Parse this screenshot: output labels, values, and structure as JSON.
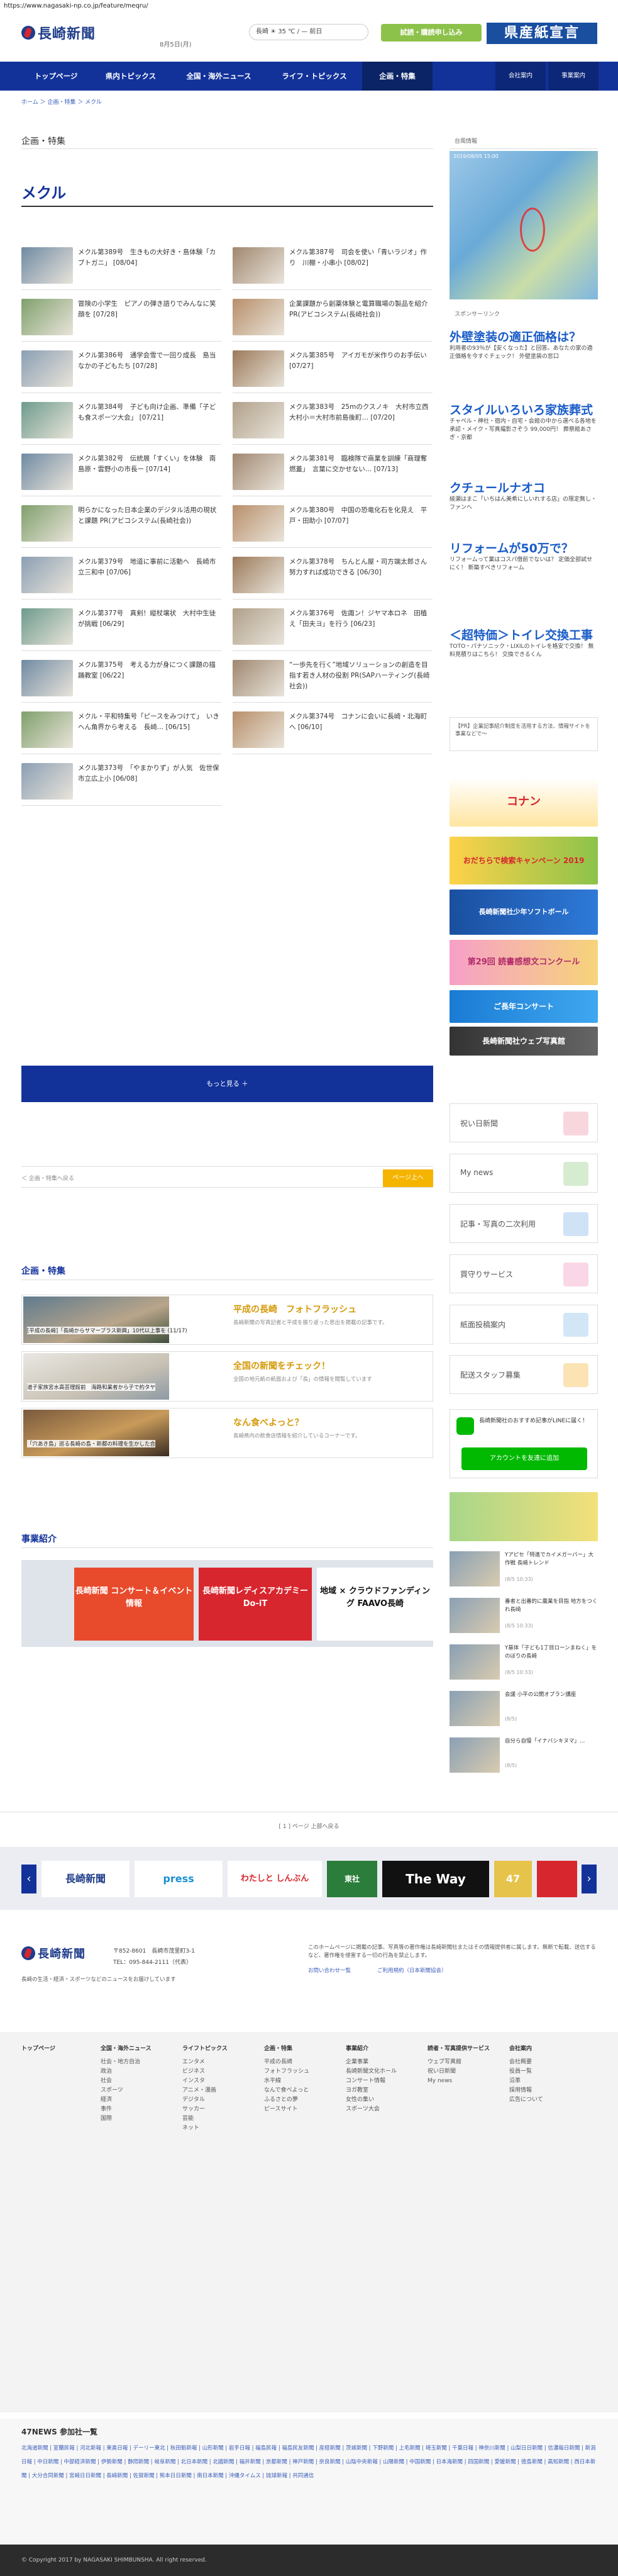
{
  "browser": {
    "url": "https://www.nagasaki-np.co.jp/feature/meqru/"
  },
  "header": {
    "logo_text": "長崎新聞",
    "date": "8月5日(月)",
    "weather": "長崎 ☀ 35 ℃ / —  前日",
    "subscribe_label": "試読・購読申し込み",
    "banner_label": "県産紙宣言"
  },
  "nav": {
    "items": [
      "トップページ",
      "県内トピックス",
      "全国・海外ニュース",
      "ライフ・トピックス",
      "企画・特集"
    ],
    "right_items": [
      "会社案内",
      "事業案内"
    ]
  },
  "breadcrumb": "ホーム ＞ 企画・特集 ＞ メクル",
  "section": {
    "title": "企画・特集",
    "page_title": "メクル"
  },
  "articles": [
    {
      "text": "メクル第389号　生きもの大好き・島体験「カブトガニ」",
      "date": "[08/04]"
    },
    {
      "text": "メクル第387号　司会を使い「青いラジオ」作り　川棚・小串小",
      "date": "[08/02]"
    },
    {
      "text": "冒険の小学生　ピアノの弾き語りでみんなに笑顔を",
      "date": "[07/28]"
    },
    {
      "text": "企業課題から創薬体験と電算職場の製品を紹介",
      "date": "PR(アビコシステム(長崎社会))"
    },
    {
      "text": "メクル第386号　通学会雪で一回り成長　島当なかの子どもたち",
      "date": "[07/28]"
    },
    {
      "text": "メクル第385号　アイガモが米作りのお手伝い",
      "date": "[07/27]"
    },
    {
      "text": "メクル第384号　子ども向け企画、準備「子ども食スポーツ大会」",
      "date": "[07/21]"
    },
    {
      "text": "メクル第383号　25mのクスノキ　大村市立西大村小＝大村市前島後町…",
      "date": "[07/20]"
    },
    {
      "text": "メクル第382号　伝統展「すくい」を体験　南島原・雲野小の市長ー",
      "date": "[07/14]"
    },
    {
      "text": "メクル第381号　臨検隊で商業を訓練「商理奪燃蓋」　言葉に交かせない…",
      "date": "[07/13]"
    },
    {
      "text": "明らかになった日本企業のデジタル活用の現状と課題",
      "date": "PR(アビコシステム(長崎社会))"
    },
    {
      "text": "メクル第380号　中国の恐竜化石を化見え　平戸・田助小",
      "date": "[07/07]"
    },
    {
      "text": "メクル第379号　地道に事前に活動へ　長崎市立三和中",
      "date": "[07/06]"
    },
    {
      "text": "メクル第378号　ちんとん屋・司方端太郎さん　努力すれば成功できる",
      "date": "[06/30]"
    },
    {
      "text": "メクル第377号　真剣！縦杖壌状　大村中生徒が挑戦",
      "date": "[06/29]"
    },
    {
      "text": "メクル第376号　佐諏ン！ジヤマ本ロネ　田植え「田夫ヨ」を行う",
      "date": "[06/23]"
    },
    {
      "text": "メクル第375号　考える力が身につく課題の描踊教室",
      "date": "[06/22]"
    },
    {
      "text": "“一歩先を行く”地域ソリューションの創造を目指す若き人材の役割",
      "date": "PR(SAPハーティング(長崎社会))"
    },
    {
      "text": "メクル・平和特集号「ピースをみつけて」　いきへん角界から考える　長崎…",
      "date": "[06/15]"
    },
    {
      "text": "メクル第374号　コナンに会いに長崎・北海町へ",
      "date": "[06/10]"
    },
    {
      "text": "メクル第373号　「やまかりず」が人気　佐世保市立広上小",
      "date": "[06/08]"
    }
  ],
  "more_button": "もっと見る ＋",
  "pager": {
    "back": "＜ 企画・特集へ戻る",
    "up": "ページ上へ"
  },
  "features": {
    "title": "企画・特集",
    "items": [
      {
        "title": "平成の長崎　フォトフラッシュ",
        "desc": "長崎新聞の写真記者と平成を振り返った思出を掲載の記事です。",
        "caption": "[平成の長崎]「長崎からサマープラス新興」10代以上事を (11/17)"
      },
      {
        "title": "全国の新聞をチェック！",
        "desc": "全国の地元紙の紙面および「長」の情報を閲覧しています",
        "caption": "道子家族宮水高芸理館前　海路和業者から子で約タヤ"
      },
      {
        "title": "なん食べよっと？",
        "desc": "長崎県内の飲食店情報を紹介しているコーナーです。",
        "caption": "「穴あき島」巡る長崎の島・新都の料理を生かした合"
      }
    ]
  },
  "business": {
    "title": "事業紹介",
    "items": [
      "長崎新聞 コンサート＆イベント情報",
      "長崎新聞レディスアカデミー Do-iT",
      "地域 × クラウドファンディング FAAVO長崎"
    ]
  },
  "sidebar": {
    "map_label": "台風情報",
    "map_time": "2019/08/05 15:00",
    "sponsored_label": "スポンサーリンク",
    "ads": [
      {
        "title": "外壁塗装の適正価格は？",
        "sub": "利用者の93％が【安くなった】と回答。あなたの家の適正価格を今すぐチェック！ 外壁塗装の窓口"
      },
      {
        "title": "スタイルいろいろ家族葬式",
        "sub": "チャペル・神社・宿内・自宅・会館の中から選べる各地を承認・メイク・写真撮影さぞう 99,000円！ 葬祭館あさぎ・京都"
      },
      {
        "title": "クチュールナオコ",
        "sub": "綾瀬はまこ「いちはん美希にしいれする店」の限定無し・ファンへ"
      },
      {
        "title": "リフォームが50万で？",
        "sub": "リフォームって業はコスパ借前でないは？ 定価全部試せにく！ 新築すべきリフォーム"
      },
      {
        "title": "＜超特価＞トイレ交換工事",
        "sub": "TOTO・パナソニック・LIXILのトイレを格安で交換！ 無料見積りはこちら！ 交換できるくん"
      }
    ],
    "notice": "【PR】企業記事紹介制度を活用する方法、情報サイトを事業などで〜",
    "links": [
      "祝い日新聞",
      "My news",
      "記事・写真の二次利用",
      "買守りサービス",
      "紙面投稿案内",
      "配送スタッフ募集"
    ],
    "line": {
      "text": "長崎新聞社のおすすめ記事がLINEに届く！",
      "button": "アカウントを友達に追加"
    },
    "banners": [
      "コナン",
      "おだちらで検索キャンペーン 2019",
      "長崎新聞社少年ソフトボール",
      "第29回 読書感想文コンクール",
      "ご長年コンサート",
      "長崎新聞社ウェブ写真館"
    ],
    "small_news": [
      {
        "text": "Yアピセ「特進でカイメガーバー」大作戦 長崎トレンド",
        "date": "(8/5 10:33)"
      },
      {
        "text": "番者と出番的に農業を目指 地方をつくれ長崎",
        "date": "(8/5 10:33)"
      },
      {
        "text": "Y基体「子ども1丁目ローンまねく」をのぼりの長崎",
        "date": "(8/5 10:33)"
      },
      {
        "text": "会議 小平の公開オプラン講座",
        "date": "(8/5)"
      },
      {
        "text": "自分ら自慢「イナバシキヌマ」…",
        "date": "(8/5)"
      }
    ]
  },
  "footer_carousel": {
    "label": "[ 1 ] ページ 上部へ戻る",
    "items": [
      "長崎新聞",
      "press",
      "わたしと しんぶん",
      "東社",
      "The Way",
      "47"
    ]
  },
  "footer": {
    "address": "〒852-8601　長崎市茂里町3-1",
    "tel": "TEL：095-844-2111（代表）",
    "note": "長崎の生活・経済・スポーツなどのニュースをお届けしています",
    "desc": "このホームページに掲載の記事、写真等の著作権は長崎新聞社またはその情報提供者に属します。無断で転載、送信するなど、著作権を侵害する一切の行為を禁止します。",
    "links": [
      "お問い合わせ一覧",
      "ご利用規約（日本新聞協会）"
    ]
  },
  "sitemap": {
    "columns": [
      {
        "head": "トップページ",
        "items": []
      },
      {
        "head": "全国・海外ニュース",
        "items": [
          "社会・地方自治",
          "政治",
          "社会",
          "スポーツ",
          "経済",
          "事件",
          "国際"
        ]
      },
      {
        "head": "ライフトピックス",
        "items": [
          "エンタメ",
          "ビジネス",
          "インスタ",
          "アニメ・漫画",
          "デジタル",
          "サッカー",
          "芸能",
          "ネット"
        ]
      },
      {
        "head": "企画・特集",
        "items": [
          "平成の長崎",
          "フォトフラッシュ",
          "水平線",
          "なんで食べよっと",
          "ふるさとの夢",
          "ピースサイト"
        ]
      },
      {
        "head": "事業紹介",
        "items": [
          "企業事業",
          "長崎新聞文化ホール",
          "コンサート情報",
          "ヨガ教室",
          "女性の集い",
          "スポーツ大会"
        ]
      },
      {
        "head": "読者・写真提供サービス",
        "items": [
          "ウェブ写真館",
          "祝い日新聞",
          "My news"
        ]
      },
      {
        "head": "会社案内",
        "items": [
          "会社概要",
          "役員一覧",
          "沿革",
          "採用情報",
          "広告について"
        ]
      }
    ]
  },
  "news47": {
    "title": "47NEWS 参加社一覧",
    "members": "北海道新聞 | 室蘭民報 | 河北新報 | 東奥日報 | デーリー東北 | 秋田魁新報 | 山形新聞 | 岩手日報 | 福島民報 | 福島民友新聞 | 産経新聞 | 茨城新聞 | 下野新聞 | 上毛新聞 | 埼玉新聞 | 千葉日報 | 神奈川新聞 | 山梨日日新聞 | 信濃毎日新聞 | 新潟日報 | 中日新聞 | 中部経済新聞 | 伊勢新聞 | 静岡新聞 | 岐阜新聞 | 北日本新聞 | 北國新聞 | 福井新聞 | 京都新聞 | 神戸新聞 | 奈良新聞 | 山陰中央新報 | 山陽新聞 | 中国新聞 | 日本海新聞 | 四国新聞 | 愛媛新聞 | 徳島新聞 | 高知新聞 | 西日本新聞 | 大分合同新聞 | 宮崎日日新聞 | 長崎新聞 | 佐賀新聞 | 熊本日日新聞 | 南日本新聞 | 沖縄タイムス | 琉球新報 | 共同通信"
  },
  "copyright": "© Copyright 2017 by NAGASAKI SHIMBUNSHA. All right reserved."
}
